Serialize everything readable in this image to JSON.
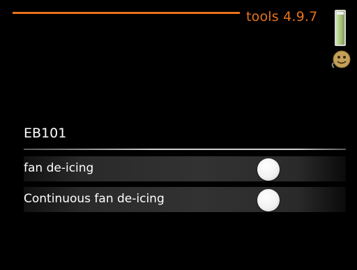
{
  "header": {
    "title": "tools 4.9.7",
    "accent_color": "#e8731a",
    "device_icon": "heat-pump-icon",
    "status_icon": "smiley-face-icon"
  },
  "section": {
    "title": "EB101"
  },
  "settings": [
    {
      "label": "fan de-icing",
      "state": "off"
    },
    {
      "label": "Continuous fan de-icing",
      "state": "off"
    }
  ]
}
